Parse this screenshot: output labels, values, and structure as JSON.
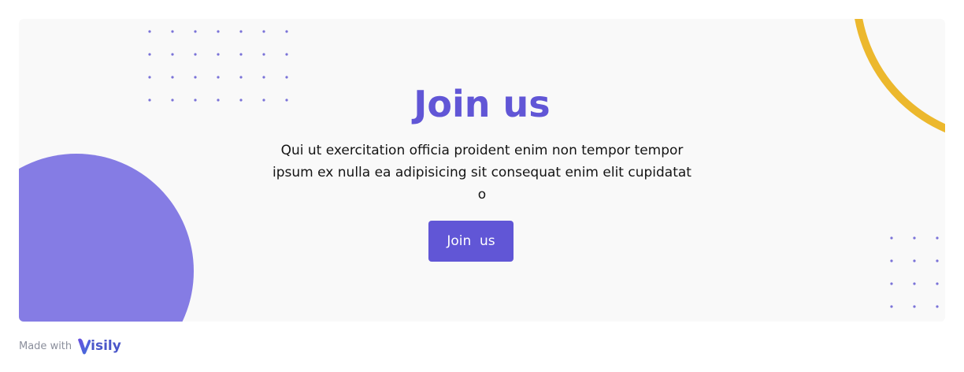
{
  "hero": {
    "title": "Join us",
    "description": "Qui ut exercitation officia proident enim non tempor tempor ipsum ex nulla ea adipisicing sit consequat enim elit cupidatat o",
    "button_label": "Join  us"
  },
  "footer": {
    "made_with": "Made with",
    "brand": "isily"
  },
  "colors": {
    "accent": "#6156d6",
    "circle": "#857ce4",
    "arc": "#ecb82d",
    "card_bg": "#f9f9f9",
    "dots": "#7a72d8"
  },
  "icons": {
    "brand_mark": "visily-v-logo-icon"
  }
}
